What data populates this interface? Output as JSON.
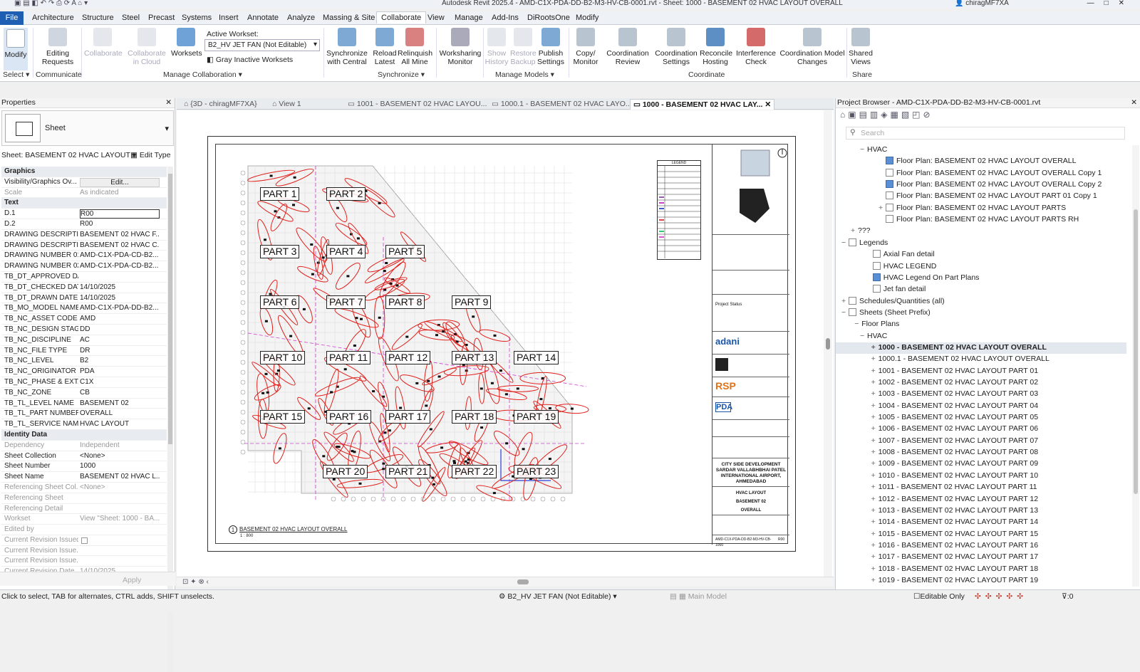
{
  "titlebar": {
    "title": "Autodesk Revit 2025.4 - AMD-C1X-PDA-DD-B2-M3-HV-CB-0001.rvt - Sheet: 1000 - BASEMENT 02 HVAC LAYOUT OVERALL",
    "user": "chiragMF7XA"
  },
  "menu": {
    "file": "File",
    "tabs": [
      "Architecture",
      "Structure",
      "Steel",
      "Precast",
      "Systems",
      "Insert",
      "Annotate",
      "Analyze",
      "Massing & Site",
      "Collaborate",
      "View",
      "Manage",
      "Add-Ins",
      "DiRootsOne",
      "Modify"
    ],
    "active": "Collaborate"
  },
  "ribbon": {
    "modify": "Modify",
    "editing_requests": "Editing Requests",
    "collaborate": "Collaborate",
    "collaborate_cloud": "Collaborate in Cloud",
    "worksets": "Worksets",
    "active_workset_label": "Active Workset:",
    "active_workset_value": "B2_HV JET FAN (Not Editable)",
    "gray_inactive": "Gray Inactive Worksets",
    "sync_central": "Synchronize with Central",
    "reload_latest": "Reload Latest",
    "relinquish_all": "Relinquish All Mine",
    "worksharing_monitor": "Worksharing Monitor",
    "show_history": "Show History",
    "restore_backup": "Restore Backup",
    "publish_settings": "Publish Settings",
    "copy_monitor": "Copy/ Monitor",
    "coordination_review": "Coordination Review",
    "coordination_settings": "Coordination Settings",
    "reconcile_hosting": "Reconcile Hosting",
    "interference_check": "Interference Check",
    "coord_model_changes": "Coordination Model Changes",
    "shared_views": "Shared Views",
    "groups": {
      "select": "Select",
      "communicate": "Communicate",
      "manage_collab": "Manage Collaboration",
      "synchronize": "Synchronize",
      "manage_models": "Manage Models",
      "coordinate": "Coordinate",
      "share": "Share"
    }
  },
  "properties": {
    "title": "Properties",
    "type": "Sheet",
    "selector": "Sheet: BASEMENT 02 HVAC LAYOUT",
    "edit_type": "Edit Type",
    "apply": "Apply",
    "rows": [
      {
        "k": "Graphics",
        "v": "",
        "sec": true
      },
      {
        "k": "Visibility/Graphics Ov...",
        "v": "Edit..."
      },
      {
        "k": "Scale",
        "v": "As indicated",
        "dim": true
      },
      {
        "k": "Text",
        "v": "",
        "sec": true
      },
      {
        "k": "D.1",
        "v": "R00"
      },
      {
        "k": "D.2",
        "v": "R00"
      },
      {
        "k": "DRAWING DESCRIPTI...",
        "v": "BASEMENT 02 HVAC F..."
      },
      {
        "k": "DRAWING DESCRIPTI...",
        "v": "BASEMENT 02 HVAC C..."
      },
      {
        "k": "DRAWING NUMBER 01",
        "v": "AMD-C1X-PDA-CD-B2..."
      },
      {
        "k": "DRAWING NUMBER 02",
        "v": "AMD-C1X-PDA-CD-B2..."
      },
      {
        "k": "TB_DT_APPROVED DA...",
        "v": ""
      },
      {
        "k": "TB_DT_CHECKED DATE",
        "v": "14/10/2025"
      },
      {
        "k": "TB_DT_DRAWN DATE",
        "v": "14/10/2025"
      },
      {
        "k": "TB_MO_MODEL NAME",
        "v": "AMD-C1X-PDA-DD-B2..."
      },
      {
        "k": "TB_NC_ASSET CODE",
        "v": "AMD"
      },
      {
        "k": "TB_NC_DESIGN STAGE",
        "v": "DD"
      },
      {
        "k": "TB_NC_DISCIPLINE",
        "v": "AC"
      },
      {
        "k": "TB_NC_FILE TYPE",
        "v": "DR"
      },
      {
        "k": "TB_NC_LEVEL",
        "v": "B2"
      },
      {
        "k": "TB_NC_ORIGINATOR",
        "v": "PDA"
      },
      {
        "k": "TB_NC_PHASE & EXT...",
        "v": "C1X"
      },
      {
        "k": "TB_NC_ZONE",
        "v": "CB"
      },
      {
        "k": "TB_TL_LEVEL NAME",
        "v": "BASEMENT 02"
      },
      {
        "k": "TB_TL_PART NUMBER",
        "v": "OVERALL"
      },
      {
        "k": "TB_TL_SERVICE NAME",
        "v": "HVAC LAYOUT"
      },
      {
        "k": "Identity Data",
        "v": "",
        "sec": true
      },
      {
        "k": "Dependency",
        "v": "Independent",
        "dim": true
      },
      {
        "k": "Sheet Collection",
        "v": "<None>"
      },
      {
        "k": "Sheet Number",
        "v": "1000"
      },
      {
        "k": "Sheet Name",
        "v": "BASEMENT 02 HVAC L..."
      },
      {
        "k": "Referencing Sheet Col...",
        "v": "<None>",
        "dim": true
      },
      {
        "k": "Referencing Sheet",
        "v": "",
        "dim": true
      },
      {
        "k": "Referencing Detail",
        "v": "",
        "dim": true
      },
      {
        "k": "Workset",
        "v": "View \"Sheet: 1000 - BA...",
        "dim": true
      },
      {
        "k": "Edited by",
        "v": "",
        "dim": true
      },
      {
        "k": "Current Revision Issued",
        "v": "",
        "dim": true
      },
      {
        "k": "Current Revision Issue...",
        "v": "",
        "dim": true
      },
      {
        "k": "Current Revision Issue...",
        "v": "",
        "dim": true
      },
      {
        "k": "Current Revision Date",
        "v": "14/10/2025",
        "dim": true
      }
    ]
  },
  "view_tabs": [
    {
      "label": "{3D - chiragMF7XA}",
      "active": false
    },
    {
      "label": "View 1",
      "active": false
    },
    {
      "label": "1001 - BASEMENT 02 HVAC LAYOU...",
      "active": false
    },
    {
      "label": "1000.1 - BASEMENT 02 HVAC LAYO...",
      "active": false
    },
    {
      "label": "1000 - BASEMENT 02 HVAC LAY...",
      "active": true
    }
  ],
  "drawing": {
    "parts": [
      "PART 1",
      "PART 2",
      "PART 3",
      "PART 4",
      "PART 5",
      "PART 6",
      "PART 7",
      "PART 8",
      "PART 9",
      "PART 10",
      "PART 11",
      "PART 12",
      "PART 13",
      "PART 14",
      "PART 15",
      "PART 16",
      "PART 17",
      "PART 18",
      "PART 19",
      "PART 20",
      "PART 21",
      "PART 22",
      "PART 23"
    ],
    "caption": "BASEMENT 02 HVAC LAYOUT OVERALL",
    "caption_scale": "1 : 800",
    "legend_title": "LEGEND",
    "tb_project_status": "Project Status",
    "tb_client": "adani",
    "tb_consultant": "RSP",
    "tb_pda": "PDA",
    "tb_project": "CITY SIDE DEVELOPMENT SARDAR VALLABHBHAI PATEL INTERNATIONAL AIRPORT, AHMEDABAD",
    "tb_title1": "HVAC LAYOUT",
    "tb_title2": "BASEMENT 02",
    "tb_title3": "OVERALL",
    "tb_drawing_no": "AMD-C1X-PDA-DD-B2-M3-HV-CB-1000",
    "tb_rev": "R00"
  },
  "browser": {
    "title": "Project Browser - AMD-C1X-PDA-DD-B2-M3-HV-CB-0001.rvt",
    "search_placeholder": "Search",
    "nodes": [
      {
        "t": "HVAC",
        "lvl": 1,
        "g": "−"
      },
      {
        "t": "Floor Plan: BASEMENT 02 HVAC LAYOUT OVERALL",
        "lvl": 2,
        "icon": "blue"
      },
      {
        "t": "Floor Plan: BASEMENT 02 HVAC LAYOUT OVERALL Copy 1",
        "lvl": 2,
        "icon": "plain"
      },
      {
        "t": "Floor Plan: BASEMENT 02 HVAC LAYOUT OVERALL Copy 2",
        "lvl": 2,
        "icon": "blue"
      },
      {
        "t": "Floor Plan: BASEMENT 02 HVAC LAYOUT PART 01 Copy 1",
        "lvl": 2,
        "icon": "plain"
      },
      {
        "t": "Floor Plan: BASEMENT 02 HVAC LAYOUT PARTS",
        "lvl": 2,
        "icon": "plain",
        "g": "+"
      },
      {
        "t": "Floor Plan: BASEMENT 02 HVAC LAYOUT PARTS RH",
        "lvl": 2,
        "icon": "plain"
      },
      {
        "t": "???",
        "lvl": 0.5,
        "g": "+"
      },
      {
        "t": "Legends",
        "lvl": 0,
        "g": "−",
        "icon": "plain"
      },
      {
        "t": "Axial Fan detail",
        "lvl": 1.3,
        "icon": "plain"
      },
      {
        "t": "HVAC LEGEND",
        "lvl": 1.3,
        "icon": "plain"
      },
      {
        "t": "HVAC Legend On Part Plans",
        "lvl": 1.3,
        "icon": "blue"
      },
      {
        "t": "Jet fan detail",
        "lvl": 1.3,
        "icon": "plain"
      },
      {
        "t": "Schedules/Quantities (all)",
        "lvl": 0,
        "g": "+",
        "icon": "plain"
      },
      {
        "t": "Sheets (Sheet Prefix)",
        "lvl": 0,
        "g": "−",
        "icon": "plain"
      },
      {
        "t": "Floor Plans",
        "lvl": 0.7,
        "g": "−"
      },
      {
        "t": "HVAC",
        "lvl": 1,
        "g": "−"
      },
      {
        "t": "1000 - BASEMENT 02 HVAC LAYOUT OVERALL",
        "lvl": 1.6,
        "g": "+",
        "bold": true,
        "sel": true
      },
      {
        "t": "1000.1 - BASEMENT 02 HVAC LAYOUT OVERALL",
        "lvl": 1.6,
        "g": "+"
      },
      {
        "t": "1001 - BASEMENT 02 HVAC LAYOUT PART 01",
        "lvl": 1.6,
        "g": "+"
      },
      {
        "t": "1002 - BASEMENT 02 HVAC LAYOUT PART 02",
        "lvl": 1.6,
        "g": "+"
      },
      {
        "t": "1003 - BASEMENT 02 HVAC LAYOUT PART 03",
        "lvl": 1.6,
        "g": "+"
      },
      {
        "t": "1004 - BASEMENT 02 HVAC LAYOUT PART 04",
        "lvl": 1.6,
        "g": "+"
      },
      {
        "t": "1005 - BASEMENT 02 HVAC LAYOUT PART 05",
        "lvl": 1.6,
        "g": "+"
      },
      {
        "t": "1006 - BASEMENT 02 HVAC LAYOUT PART 06",
        "lvl": 1.6,
        "g": "+"
      },
      {
        "t": "1007 - BASEMENT 02 HVAC LAYOUT PART 07",
        "lvl": 1.6,
        "g": "+"
      },
      {
        "t": "1008 - BASEMENT 02 HVAC LAYOUT PART 08",
        "lvl": 1.6,
        "g": "+"
      },
      {
        "t": "1009 - BASEMENT 02 HVAC LAYOUT PART 09",
        "lvl": 1.6,
        "g": "+"
      },
      {
        "t": "1010 - BASEMENT 02 HVAC LAYOUT PART 10",
        "lvl": 1.6,
        "g": "+"
      },
      {
        "t": "1011 - BASEMENT 02 HVAC LAYOUT PART 11",
        "lvl": 1.6,
        "g": "+"
      },
      {
        "t": "1012 - BASEMENT 02 HVAC LAYOUT PART 12",
        "lvl": 1.6,
        "g": "+"
      },
      {
        "t": "1013 - BASEMENT 02 HVAC LAYOUT PART 13",
        "lvl": 1.6,
        "g": "+"
      },
      {
        "t": "1014 - BASEMENT 02 HVAC LAYOUT PART 14",
        "lvl": 1.6,
        "g": "+"
      },
      {
        "t": "1015 - BASEMENT 02 HVAC LAYOUT PART 15",
        "lvl": 1.6,
        "g": "+"
      },
      {
        "t": "1016 - BASEMENT 02 HVAC LAYOUT PART 16",
        "lvl": 1.6,
        "g": "+"
      },
      {
        "t": "1017 - BASEMENT 02 HVAC LAYOUT PART 17",
        "lvl": 1.6,
        "g": "+"
      },
      {
        "t": "1018 - BASEMENT 02 HVAC LAYOUT PART 18",
        "lvl": 1.6,
        "g": "+"
      },
      {
        "t": "1019 - BASEMENT 02 HVAC LAYOUT PART 19",
        "lvl": 1.6,
        "g": "+"
      }
    ]
  },
  "status": {
    "hint": "Click to select, TAB for alternates, CTRL adds, SHIFT unselects.",
    "workset": "B2_HV JET FAN (Not Editable)",
    "design_option": "Main Model",
    "editable_only": "Editable Only",
    "filter_count": ":0"
  },
  "colors": {
    "accent": "#1e5fb4",
    "duct_red": "#e0201c",
    "boundary_magenta": "#d23cd2"
  }
}
